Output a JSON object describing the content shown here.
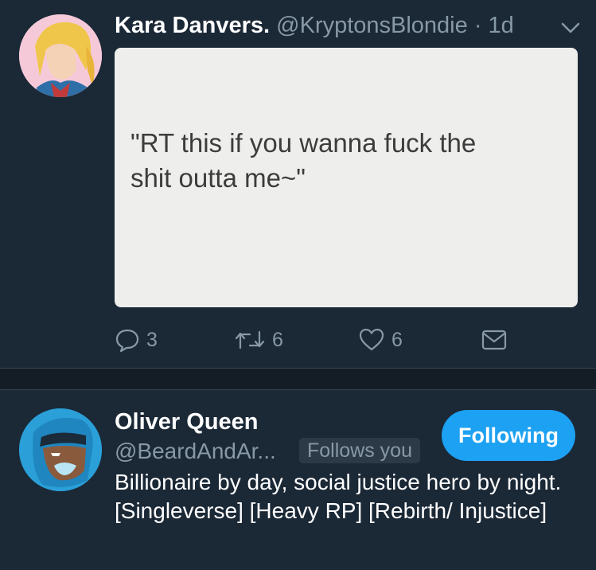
{
  "tweet": {
    "author_name": "Kara Danvers.",
    "author_handle": "@KryptonsBlondie",
    "separator": "·",
    "time": "1d",
    "media_text_line1": "\"RT this if you wanna fuck the",
    "media_text_line2": "shit outta me~\"",
    "reply_count": "3",
    "retweet_count": "6",
    "like_count": "6"
  },
  "user_card": {
    "name": "Oliver Queen",
    "handle": "@BeardAndAr...",
    "follows_you": "Follows you",
    "follow_button": "Following",
    "bio": "Billionaire by day, social justice hero by night. [Singleverse] [Heavy RP] [Rebirth/ Injustice]"
  },
  "colors": {
    "background": "#1b2836",
    "accent": "#1da1f2",
    "muted": "#8899a6"
  },
  "icons": [
    "reply-icon",
    "retweet-icon",
    "like-icon",
    "message-icon",
    "chevron-down-icon"
  ]
}
